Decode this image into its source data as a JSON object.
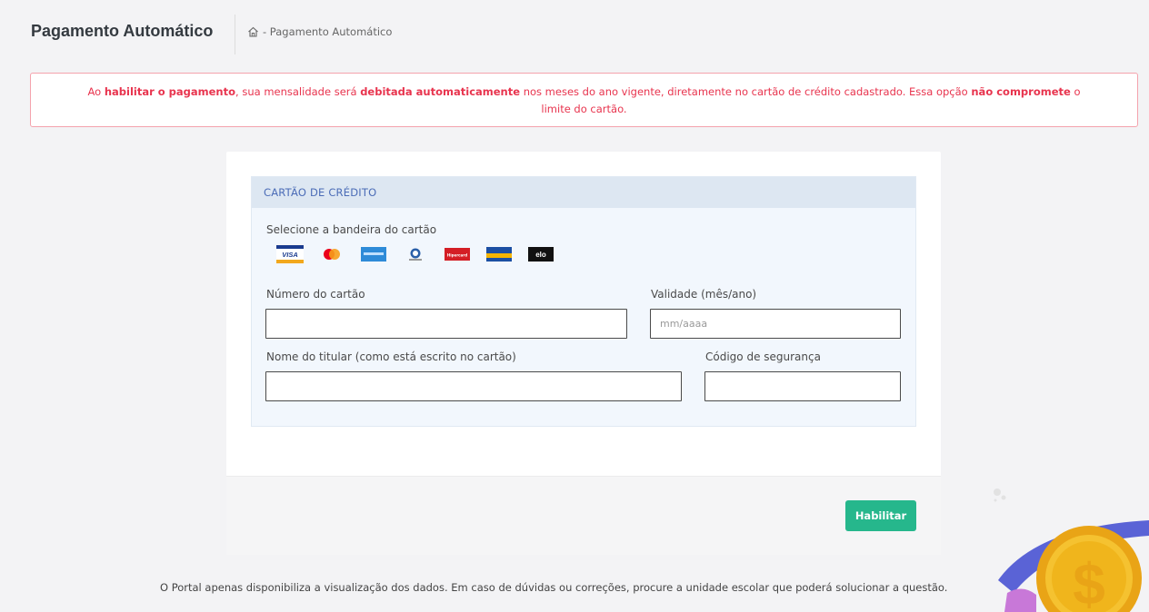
{
  "page": {
    "title": "Pagamento Automático",
    "breadcrumb": "- Pagamento Automático"
  },
  "alert": {
    "p1": "Ao ",
    "b1": "habilitar o pagamento",
    "p2": ", sua mensalidade será ",
    "b2": "debitada automaticamente",
    "p3": " nos meses do ano vigente, diretamente no cartão de crédito cadastrado. Essa opção ",
    "b3": "não compromete",
    "p4": " o",
    "line2": "limite do cartão."
  },
  "credit_card": {
    "header": "CARTÃO DE CRÉDITO",
    "select_brand_label": "Selecione a bandeira do cartão",
    "brands": [
      {
        "name": "VISA",
        "text": "VISA"
      },
      {
        "name": "Mastercard",
        "text": ""
      },
      {
        "name": "American Express",
        "text": ""
      },
      {
        "name": "Diners Club",
        "text": ""
      },
      {
        "name": "Hipercard",
        "text": "Hipercard"
      },
      {
        "name": "Banescard",
        "text": ""
      },
      {
        "name": "elo",
        "text": "elo"
      }
    ],
    "number_label": "Número do cartão",
    "number_value": "",
    "expiry_label": "Validade (mês/ano)",
    "expiry_placeholder": "mm/aaaa",
    "holder_label": "Nome do titular (como está escrito no cartão)",
    "holder_value": "",
    "cvv_label": "Código de segurança",
    "cvv_value": ""
  },
  "actions": {
    "enable_label": "Habilitar"
  },
  "footer": {
    "note": "O Portal apenas disponibiliza a visualização dos dados. Em caso de dúvidas ou correções, procure a unidade escolar que poderá solucionar a questão."
  },
  "colors": {
    "alert_text": "#e8344e",
    "alert_border": "#f4a3ad",
    "panel_header_bg": "#dde7f2",
    "panel_header_text": "#4b6cb7",
    "button_bg": "#26b78c",
    "coin": "#f0b51c"
  }
}
